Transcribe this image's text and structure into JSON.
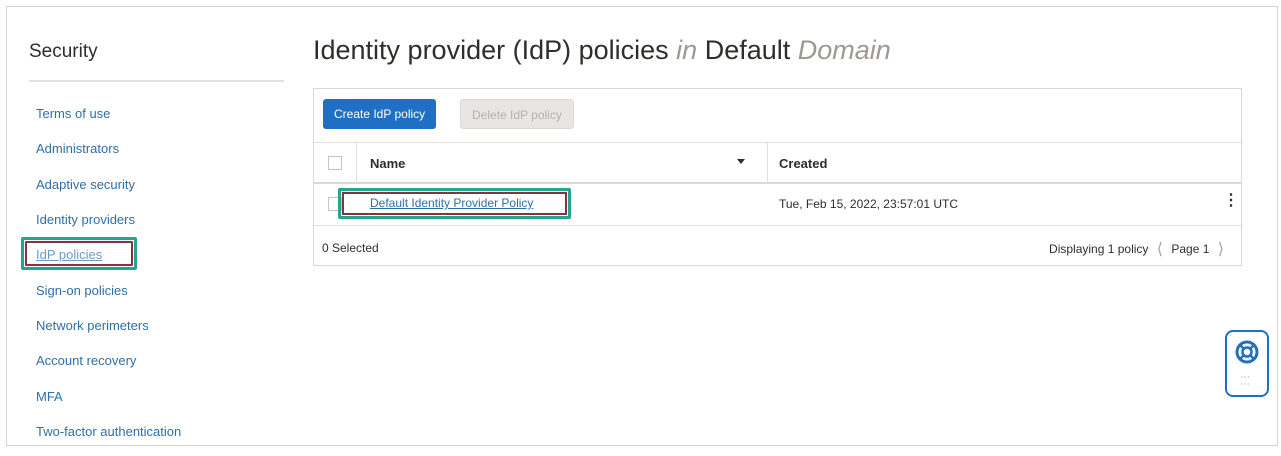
{
  "sidebar": {
    "title": "Security",
    "items": [
      {
        "label": "Terms of use"
      },
      {
        "label": "Administrators"
      },
      {
        "label": "Adaptive security"
      },
      {
        "label": "Identity providers"
      },
      {
        "label": "IdP policies",
        "selected": true
      },
      {
        "label": "Sign-on policies"
      },
      {
        "label": "Network perimeters"
      },
      {
        "label": "Account recovery"
      },
      {
        "label": "MFA"
      },
      {
        "label": "Two-factor authentication"
      }
    ]
  },
  "header": {
    "title_main": "Identity provider (IdP) policies",
    "title_in": "in",
    "title_domain": "Default",
    "title_domain_suffix": "Domain"
  },
  "toolbar": {
    "create_label": "Create IdP policy",
    "delete_label": "Delete IdP policy"
  },
  "table": {
    "columns": [
      "Name",
      "Created"
    ],
    "rows": [
      {
        "name": "Default Identity Provider Policy",
        "created": "Tue, Feb 15, 2022, 23:57:01 UTC"
      }
    ],
    "selected_count": "0 Selected",
    "display_count": "Displaying 1 policy",
    "page_label": "Page 1"
  },
  "colors": {
    "accent": "#1f6fc4",
    "link": "#2e6fa8",
    "highlight_outer": "#23a68d",
    "highlight_inner": "#8a3040"
  },
  "icons": {
    "sort": "caret-down-icon",
    "row_actions": "kebab-menu-icon",
    "prev": "chevron-left-icon",
    "next": "chevron-right-icon",
    "help": "lifebuoy-icon"
  }
}
